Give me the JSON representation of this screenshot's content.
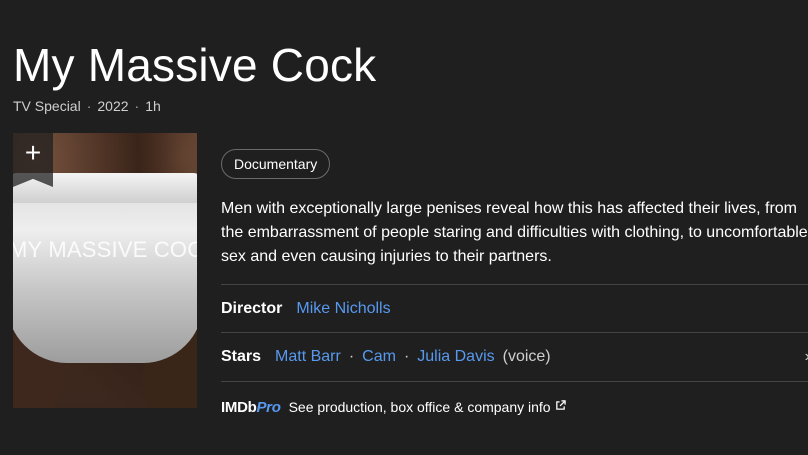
{
  "title": "My Massive Cock",
  "meta": {
    "type": "TV Special",
    "year": "2022",
    "runtime": "1h",
    "separator": "·"
  },
  "poster": {
    "overlay_text": "MY MASSIVE COC",
    "add_icon": "plus-icon"
  },
  "genre": "Documentary",
  "plot": "Men with exceptionally large penises reveal how this has affected their lives, from the embarrassment of people staring and difficulties with clothing, to uncomfortable sex and even causing injuries to their partners.",
  "director": {
    "label": "Director",
    "name": "Mike Nicholls"
  },
  "stars": {
    "label": "Stars",
    "names": [
      "Matt Barr",
      "Cam",
      "Julia Davis"
    ],
    "note": "(voice)",
    "chevron_icon": "chevron-right-icon"
  },
  "imdbpro": {
    "logo_imdb": "IMDb",
    "logo_pro": "Pro",
    "text": "See production, box office & company info",
    "icon": "external-link-icon"
  },
  "colors": {
    "background": "#1f1f1f",
    "link": "#5799ef",
    "divider": "#454545"
  }
}
